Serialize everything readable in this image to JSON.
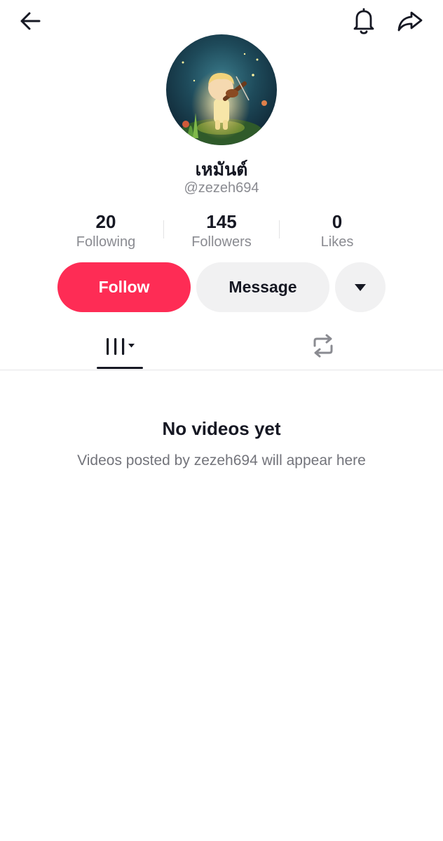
{
  "profile": {
    "display_name": "เหมันต์",
    "username": "@zezeh694"
  },
  "stats": {
    "following": {
      "value": "20",
      "label": "Following"
    },
    "followers": {
      "value": "145",
      "label": "Followers"
    },
    "likes": {
      "value": "0",
      "label": "Likes"
    }
  },
  "actions": {
    "follow_label": "Follow",
    "message_label": "Message"
  },
  "empty_state": {
    "title": "No videos yet",
    "subtitle": "Videos posted by zezeh694 will appear here"
  },
  "icons": {
    "back": "arrow-left-icon",
    "notifications": "bell-icon",
    "share": "share-arrow-icon",
    "more": "caret-down-icon",
    "videos_tab": "video-grid-icon",
    "reposts_tab": "repost-icon"
  },
  "colors": {
    "brand": "#fe2c55",
    "secondary_button": "#f1f1f2",
    "text_primary": "#161823",
    "text_secondary": "#8a8b91"
  }
}
